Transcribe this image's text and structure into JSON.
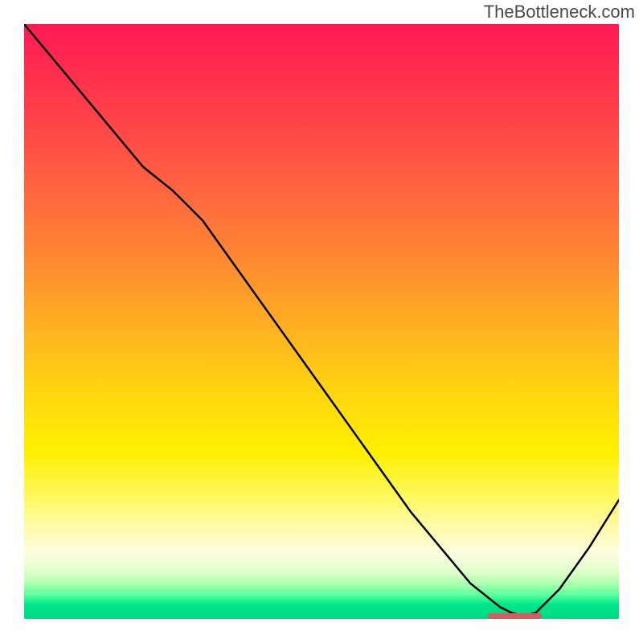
{
  "watermark": "TheBottleneck.com",
  "chart_data": {
    "type": "line",
    "title": "",
    "xlabel": "",
    "ylabel": "",
    "xlim": [
      0,
      100
    ],
    "ylim": [
      0,
      100
    ],
    "series": [
      {
        "name": "curve",
        "x": [
          0,
          5,
          10,
          15,
          20,
          25,
          30,
          35,
          40,
          45,
          50,
          55,
          60,
          65,
          70,
          75,
          80,
          82,
          84,
          86,
          90,
          95,
          100
        ],
        "y": [
          100,
          94,
          88,
          82,
          76,
          72,
          67,
          60,
          53,
          46,
          39,
          32,
          25,
          18,
          12,
          6,
          2,
          1,
          0.5,
          1,
          5,
          12,
          20
        ]
      }
    ],
    "optimal_marker": {
      "x_start": 78,
      "x_end": 87,
      "y": 0.5
    },
    "gradient_stops": [
      {
        "pos": 0,
        "color": "#ff1a54"
      },
      {
        "pos": 50,
        "color": "#ffb420"
      },
      {
        "pos": 75,
        "color": "#fff000"
      },
      {
        "pos": 100,
        "color": "#00d884"
      }
    ]
  }
}
